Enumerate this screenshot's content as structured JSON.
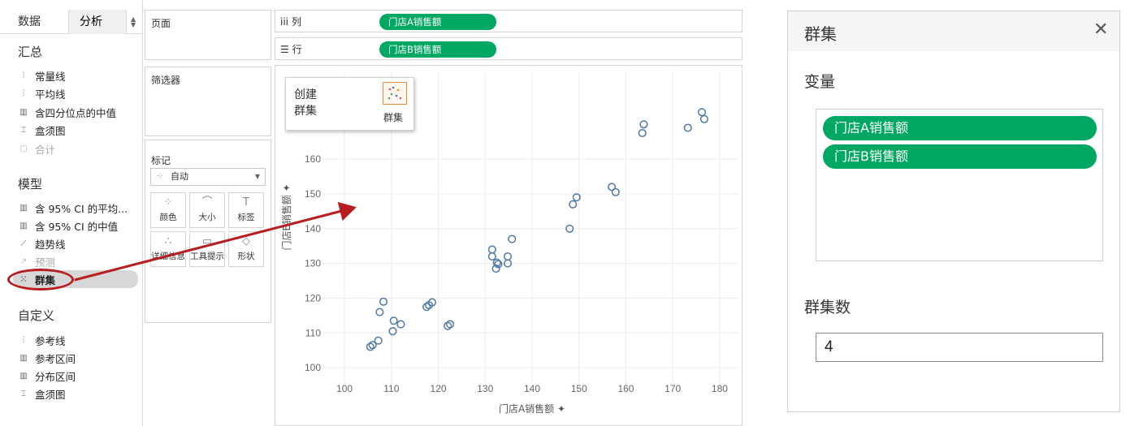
{
  "left_pane": {
    "tabs": [
      "数据",
      "分析"
    ],
    "sections": {
      "summary": {
        "title": "汇总",
        "items": [
          {
            "label": "常量线",
            "icon": "constant-line-icon",
            "glyph": "⫶",
            "disabled": false
          },
          {
            "label": "平均线",
            "icon": "average-line-icon",
            "glyph": "⫶",
            "disabled": false
          },
          {
            "label": "含四分位点的中值",
            "icon": "median-quartiles-icon",
            "glyph": "▥",
            "disabled": false
          },
          {
            "label": "盒须图",
            "icon": "box-plot-icon",
            "glyph": "⌶",
            "disabled": false
          },
          {
            "label": "合计",
            "icon": "totals-icon",
            "glyph": "▢",
            "disabled": true
          }
        ]
      },
      "model": {
        "title": "模型",
        "items": [
          {
            "label": "含 95% CI 的平均...",
            "icon": "average-ci-icon",
            "glyph": "▥",
            "disabled": false
          },
          {
            "label": "含 95% CI 的中值",
            "icon": "median-ci-icon",
            "glyph": "▥",
            "disabled": false
          },
          {
            "label": "趋势线",
            "icon": "trend-line-icon",
            "glyph": "⟋",
            "disabled": false
          },
          {
            "label": "预测",
            "icon": "forecast-icon",
            "glyph": "↗",
            "disabled": true
          },
          {
            "label": "群集",
            "icon": "cluster-icon",
            "glyph": "⁙",
            "disabled": false
          }
        ]
      },
      "custom": {
        "title": "自定义",
        "items": [
          {
            "label": "参考线",
            "icon": "reference-line-icon",
            "glyph": "⫶",
            "disabled": false
          },
          {
            "label": "参考区间",
            "icon": "reference-band-icon",
            "glyph": "▥",
            "disabled": false
          },
          {
            "label": "分布区间",
            "icon": "distribution-band-icon",
            "glyph": "▥",
            "disabled": false
          },
          {
            "label": "盒须图",
            "icon": "box-plot-icon",
            "glyph": "⌶",
            "disabled": false
          }
        ]
      }
    }
  },
  "cards": {
    "pages": "页面",
    "filters": "筛选器",
    "marks": "标记",
    "marks_type": "自动",
    "mark_buttons": [
      {
        "label": "颜色",
        "glyph": "⁘",
        "name": "color"
      },
      {
        "label": "大小",
        "glyph": "⌒",
        "name": "size"
      },
      {
        "label": "标签",
        "glyph": "T",
        "name": "label"
      },
      {
        "label": "详细信息",
        "glyph": "∴",
        "name": "detail"
      },
      {
        "label": "工具提示",
        "glyph": "▭",
        "name": "tooltip"
      },
      {
        "label": "形状",
        "glyph": "◇",
        "name": "shape"
      }
    ]
  },
  "shelves": {
    "columns_label": "iii 列",
    "rows_label": "☰ 行",
    "columns_pill": "门店A销售额",
    "rows_pill": "门店B销售额"
  },
  "create_popup": {
    "line1": "创建",
    "line2": "群集",
    "thumb_label": "群集"
  },
  "chart_data": {
    "type": "scatter",
    "xlabel": "门店A销售额",
    "ylabel": "门店B销售额",
    "x_ticks": [
      100,
      110,
      120,
      130,
      140,
      150,
      160,
      170,
      180
    ],
    "y_ticks": [
      100,
      110,
      120,
      130,
      140,
      150,
      160
    ],
    "xlim": [
      96,
      184
    ],
    "ylim": [
      97,
      185
    ],
    "grid": true,
    "points": [
      [
        105.5,
        106
      ],
      [
        106,
        106.5
      ],
      [
        107.2,
        107.8
      ],
      [
        107.5,
        116
      ],
      [
        108.3,
        119
      ],
      [
        110.3,
        110.5
      ],
      [
        110.5,
        113.5
      ],
      [
        112,
        112.5
      ],
      [
        117.5,
        117.5
      ],
      [
        118,
        118
      ],
      [
        118.7,
        118.8
      ],
      [
        122,
        112
      ],
      [
        122.5,
        112.5
      ],
      [
        131.5,
        134
      ],
      [
        131.5,
        132
      ],
      [
        132.3,
        128.5
      ],
      [
        132.5,
        130.2
      ],
      [
        132.8,
        129.8
      ],
      [
        134.8,
        132
      ],
      [
        134.8,
        130
      ],
      [
        135.7,
        137
      ],
      [
        148,
        140
      ],
      [
        148.7,
        147
      ],
      [
        149.5,
        149
      ],
      [
        157,
        152
      ],
      [
        157.8,
        150.5
      ],
      [
        163.5,
        167.5
      ],
      [
        163.8,
        170
      ],
      [
        173.2,
        169
      ],
      [
        176.2,
        173.5
      ],
      [
        176.7,
        171.5
      ]
    ]
  },
  "cluster_dialog": {
    "title": "群集",
    "variables_label": "变量",
    "variables": [
      "门店A销售额",
      "门店B销售额"
    ],
    "count_label": "群集数",
    "count_value": "4"
  },
  "colors": {
    "pill_green": "#00a863",
    "point_stroke": "#4e79a7",
    "annotation_red": "#b81e20"
  }
}
